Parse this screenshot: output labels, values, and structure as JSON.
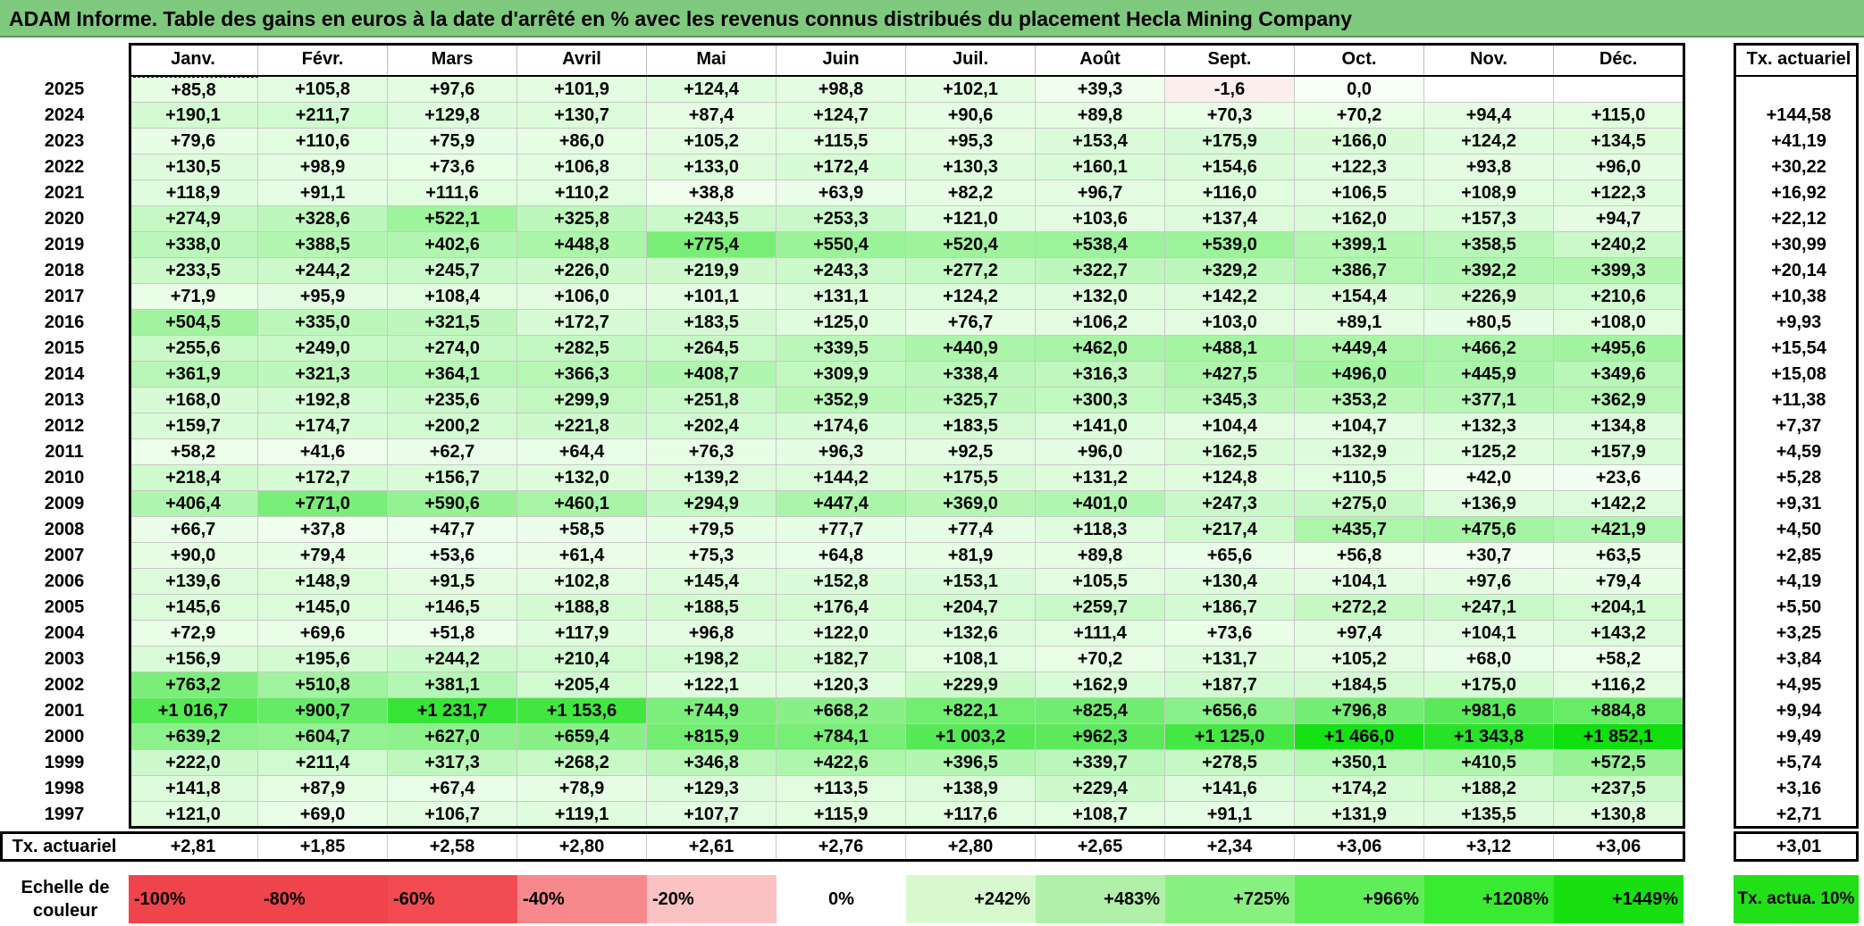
{
  "title": "ADAM Informe. Table des gains en euros à la date d'arrêté en % avec les revenus connus distribués du placement Hecla Mining Company",
  "months": [
    "Janv.",
    "Févr.",
    "Mars",
    "Avril",
    "Mai",
    "Juin",
    "Juil.",
    "Août",
    "Sept.",
    "Oct.",
    "Nov.",
    "Déc."
  ],
  "tx_header": "Tx. actuariel",
  "rows": [
    {
      "year": "2025",
      "vals": [
        "+85,8",
        "+105,8",
        "+97,6",
        "+101,9",
        "+124,4",
        "+98,8",
        "+102,1",
        "+39,3",
        "-1,6",
        "0,0",
        "",
        ""
      ],
      "tx": ""
    },
    {
      "year": "2024",
      "vals": [
        "+190,1",
        "+211,7",
        "+129,8",
        "+130,7",
        "+87,4",
        "+124,7",
        "+90,6",
        "+89,8",
        "+70,3",
        "+70,2",
        "+94,4",
        "+115,0"
      ],
      "tx": "+144,58"
    },
    {
      "year": "2023",
      "vals": [
        "+79,6",
        "+110,6",
        "+75,9",
        "+86,0",
        "+105,2",
        "+115,5",
        "+95,3",
        "+153,4",
        "+175,9",
        "+166,0",
        "+124,2",
        "+134,5"
      ],
      "tx": "+41,19"
    },
    {
      "year": "2022",
      "vals": [
        "+130,5",
        "+98,9",
        "+73,6",
        "+106,8",
        "+133,0",
        "+172,4",
        "+130,3",
        "+160,1",
        "+154,6",
        "+122,3",
        "+93,8",
        "+96,0"
      ],
      "tx": "+30,22"
    },
    {
      "year": "2021",
      "vals": [
        "+118,9",
        "+91,1",
        "+111,6",
        "+110,2",
        "+38,8",
        "+63,9",
        "+82,2",
        "+96,7",
        "+116,0",
        "+106,5",
        "+108,9",
        "+122,3"
      ],
      "tx": "+16,92"
    },
    {
      "year": "2020",
      "vals": [
        "+274,9",
        "+328,6",
        "+522,1",
        "+325,8",
        "+243,5",
        "+253,3",
        "+121,0",
        "+103,6",
        "+137,4",
        "+162,0",
        "+157,3",
        "+94,7"
      ],
      "tx": "+22,12"
    },
    {
      "year": "2019",
      "vals": [
        "+338,0",
        "+388,5",
        "+402,6",
        "+448,8",
        "+775,4",
        "+550,4",
        "+520,4",
        "+538,4",
        "+539,0",
        "+399,1",
        "+358,5",
        "+240,2"
      ],
      "tx": "+30,99"
    },
    {
      "year": "2018",
      "vals": [
        "+233,5",
        "+244,2",
        "+245,7",
        "+226,0",
        "+219,9",
        "+243,3",
        "+277,2",
        "+322,7",
        "+329,2",
        "+386,7",
        "+392,2",
        "+399,3"
      ],
      "tx": "+20,14"
    },
    {
      "year": "2017",
      "vals": [
        "+71,9",
        "+95,9",
        "+108,4",
        "+106,0",
        "+101,1",
        "+131,1",
        "+124,2",
        "+132,0",
        "+142,2",
        "+154,4",
        "+226,9",
        "+210,6"
      ],
      "tx": "+10,38"
    },
    {
      "year": "2016",
      "vals": [
        "+504,5",
        "+335,0",
        "+321,5",
        "+172,7",
        "+183,5",
        "+125,0",
        "+76,7",
        "+106,2",
        "+103,0",
        "+89,1",
        "+80,5",
        "+108,0"
      ],
      "tx": "+9,93"
    },
    {
      "year": "2015",
      "vals": [
        "+255,6",
        "+249,0",
        "+274,0",
        "+282,5",
        "+264,5",
        "+339,5",
        "+440,9",
        "+462,0",
        "+488,1",
        "+449,4",
        "+466,2",
        "+495,6"
      ],
      "tx": "+15,54"
    },
    {
      "year": "2014",
      "vals": [
        "+361,9",
        "+321,3",
        "+364,1",
        "+366,3",
        "+408,7",
        "+309,9",
        "+338,4",
        "+316,3",
        "+427,5",
        "+496,0",
        "+445,9",
        "+349,6"
      ],
      "tx": "+15,08"
    },
    {
      "year": "2013",
      "vals": [
        "+168,0",
        "+192,8",
        "+235,6",
        "+299,9",
        "+251,8",
        "+352,9",
        "+325,7",
        "+300,3",
        "+345,3",
        "+353,2",
        "+377,1",
        "+362,9"
      ],
      "tx": "+11,38"
    },
    {
      "year": "2012",
      "vals": [
        "+159,7",
        "+174,7",
        "+200,2",
        "+221,8",
        "+202,4",
        "+174,6",
        "+183,5",
        "+141,0",
        "+104,4",
        "+104,7",
        "+132,3",
        "+134,8"
      ],
      "tx": "+7,37"
    },
    {
      "year": "2011",
      "vals": [
        "+58,2",
        "+41,6",
        "+62,7",
        "+64,4",
        "+76,3",
        "+96,3",
        "+92,5",
        "+96,0",
        "+162,5",
        "+132,9",
        "+125,2",
        "+157,9"
      ],
      "tx": "+4,59"
    },
    {
      "year": "2010",
      "vals": [
        "+218,4",
        "+172,7",
        "+156,7",
        "+132,0",
        "+139,2",
        "+144,2",
        "+175,5",
        "+131,2",
        "+124,8",
        "+110,5",
        "+42,0",
        "+23,6"
      ],
      "tx": "+5,28"
    },
    {
      "year": "2009",
      "vals": [
        "+406,4",
        "+771,0",
        "+590,6",
        "+460,1",
        "+294,9",
        "+447,4",
        "+369,0",
        "+401,0",
        "+247,3",
        "+275,0",
        "+136,9",
        "+142,2"
      ],
      "tx": "+9,31"
    },
    {
      "year": "2008",
      "vals": [
        "+66,7",
        "+37,8",
        "+47,7",
        "+58,5",
        "+79,5",
        "+77,7",
        "+77,4",
        "+118,3",
        "+217,4",
        "+435,7",
        "+475,6",
        "+421,9"
      ],
      "tx": "+4,50"
    },
    {
      "year": "2007",
      "vals": [
        "+90,0",
        "+79,4",
        "+53,6",
        "+61,4",
        "+75,3",
        "+64,8",
        "+81,9",
        "+89,8",
        "+65,6",
        "+56,8",
        "+30,7",
        "+63,5"
      ],
      "tx": "+2,85"
    },
    {
      "year": "2006",
      "vals": [
        "+139,6",
        "+148,9",
        "+91,5",
        "+102,8",
        "+145,4",
        "+152,8",
        "+153,1",
        "+105,5",
        "+130,4",
        "+104,1",
        "+97,6",
        "+79,4"
      ],
      "tx": "+4,19"
    },
    {
      "year": "2005",
      "vals": [
        "+145,6",
        "+145,0",
        "+146,5",
        "+188,8",
        "+188,5",
        "+176,4",
        "+204,7",
        "+259,7",
        "+186,7",
        "+272,2",
        "+247,1",
        "+204,1"
      ],
      "tx": "+5,50"
    },
    {
      "year": "2004",
      "vals": [
        "+72,9",
        "+69,6",
        "+51,8",
        "+117,9",
        "+96,8",
        "+122,0",
        "+132,6",
        "+111,4",
        "+73,6",
        "+97,4",
        "+104,1",
        "+143,2"
      ],
      "tx": "+3,25"
    },
    {
      "year": "2003",
      "vals": [
        "+156,9",
        "+195,6",
        "+244,2",
        "+210,4",
        "+198,2",
        "+182,7",
        "+108,1",
        "+70,2",
        "+131,7",
        "+105,2",
        "+68,0",
        "+58,2"
      ],
      "tx": "+3,84"
    },
    {
      "year": "2002",
      "vals": [
        "+763,2",
        "+510,8",
        "+381,1",
        "+205,4",
        "+122,1",
        "+120,3",
        "+229,9",
        "+162,9",
        "+187,7",
        "+184,5",
        "+175,0",
        "+116,2"
      ],
      "tx": "+4,95"
    },
    {
      "year": "2001",
      "vals": [
        "+1 016,7",
        "+900,7",
        "+1 231,7",
        "+1 153,6",
        "+744,9",
        "+668,2",
        "+822,1",
        "+825,4",
        "+656,6",
        "+796,8",
        "+981,6",
        "+884,8"
      ],
      "tx": "+9,94"
    },
    {
      "year": "2000",
      "vals": [
        "+639,2",
        "+604,7",
        "+627,0",
        "+659,4",
        "+815,9",
        "+784,1",
        "+1 003,2",
        "+962,3",
        "+1 125,0",
        "+1 466,0",
        "+1 343,8",
        "+1 852,1"
      ],
      "tx": "+9,49"
    },
    {
      "year": "1999",
      "vals": [
        "+222,0",
        "+211,4",
        "+317,3",
        "+268,2",
        "+346,8",
        "+422,6",
        "+396,5",
        "+339,7",
        "+278,5",
        "+350,1",
        "+410,5",
        "+572,5"
      ],
      "tx": "+5,74"
    },
    {
      "year": "1998",
      "vals": [
        "+141,8",
        "+87,9",
        "+67,4",
        "+78,9",
        "+129,3",
        "+113,5",
        "+138,9",
        "+229,4",
        "+141,6",
        "+174,2",
        "+188,2",
        "+237,5"
      ],
      "tx": "+3,16"
    },
    {
      "year": "1997",
      "vals": [
        "+121,0",
        "+69,0",
        "+106,7",
        "+119,1",
        "+107,7",
        "+115,9",
        "+117,6",
        "+108,7",
        "+91,1",
        "+131,9",
        "+135,5",
        "+130,8"
      ],
      "tx": "+2,71"
    }
  ],
  "footer": {
    "label": "Tx. actuariel",
    "vals": [
      "+2,81",
      "+1,85",
      "+2,58",
      "+2,80",
      "+2,61",
      "+2,76",
      "+2,80",
      "+2,65",
      "+2,34",
      "+3,06",
      "+3,12",
      "+3,06"
    ],
    "tx": "+3,01"
  },
  "scale": {
    "label": "Echelle de couleur",
    "items": [
      {
        "text": "-100%",
        "color": "#f0444c",
        "align": "left"
      },
      {
        "text": "-80%",
        "color": "#f0444c",
        "align": "left"
      },
      {
        "text": "-60%",
        "color": "#f24c52",
        "align": "left"
      },
      {
        "text": "-40%",
        "color": "#f7888c",
        "align": "left"
      },
      {
        "text": "-20%",
        "color": "#fbc2c4",
        "align": "left"
      },
      {
        "text": "0%",
        "color": "#ffffff",
        "align": "center"
      },
      {
        "text": "+242%",
        "color": "#d8f8d0",
        "align": "right"
      },
      {
        "text": "+483%",
        "color": "#b0f0a8",
        "align": "right"
      },
      {
        "text": "+725%",
        "color": "#88f080",
        "align": "right"
      },
      {
        "text": "+966%",
        "color": "#60ee58",
        "align": "right"
      },
      {
        "text": "+1208%",
        "color": "#38ea30",
        "align": "right"
      },
      {
        "text": "+1449%",
        "color": "#18e010",
        "align": "right"
      }
    ],
    "tx_label": "Tx. actua. 10%",
    "tx_color": "#22e018"
  },
  "colors": {
    "title_bg": "#7fc97f",
    "max_green": "#10e010",
    "negative_pink": "#fdeeee"
  }
}
